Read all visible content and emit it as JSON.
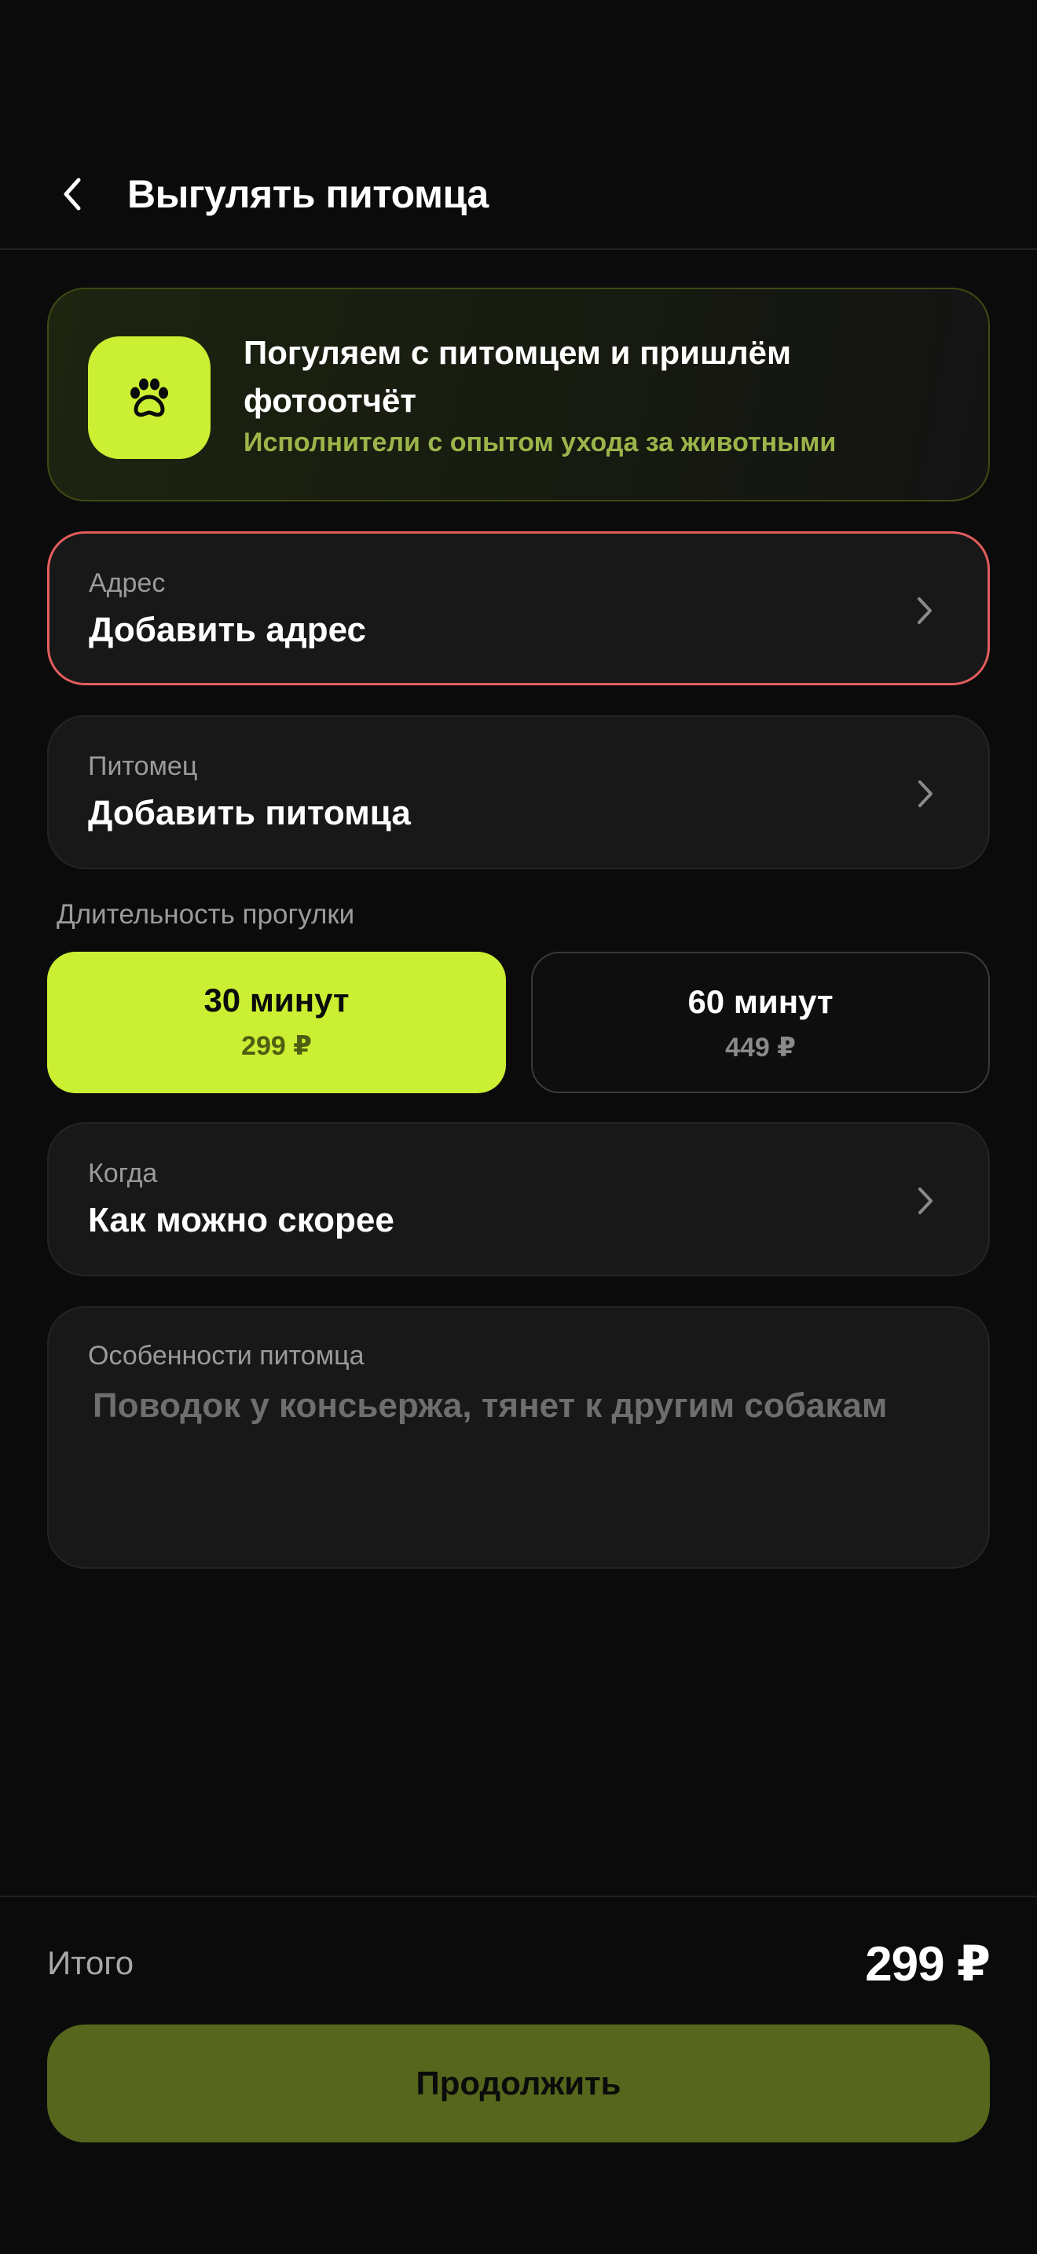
{
  "header": {
    "title": "Выгулять питомца"
  },
  "promo": {
    "title": "Погуляем с питомцем и пришлём фотоотчёт",
    "subtitle": "Исполнители с опытом ухода за животными"
  },
  "address": {
    "label": "Адрес",
    "value": "Добавить адрес"
  },
  "pet": {
    "label": "Питомец",
    "value": "Добавить питомца"
  },
  "duration": {
    "label": "Длительность прогулки",
    "options": [
      {
        "title": "30 минут",
        "price": "299 ₽",
        "selected": true
      },
      {
        "title": "60 минут",
        "price": "449 ₽",
        "selected": false
      }
    ]
  },
  "when": {
    "label": "Когда",
    "value": "Как можно скорее"
  },
  "notes": {
    "label": "Особенности питомца",
    "placeholder": "Поводок у консьержа, тянет к другим собакам"
  },
  "footer": {
    "total_label": "Итого",
    "total_value": "299 ₽",
    "continue_label": "Продолжить"
  },
  "colors": {
    "accent": "#cbef32",
    "background": "#0b0b0b",
    "error_border": "#e45d5d",
    "button_disabled": "#56661c"
  }
}
